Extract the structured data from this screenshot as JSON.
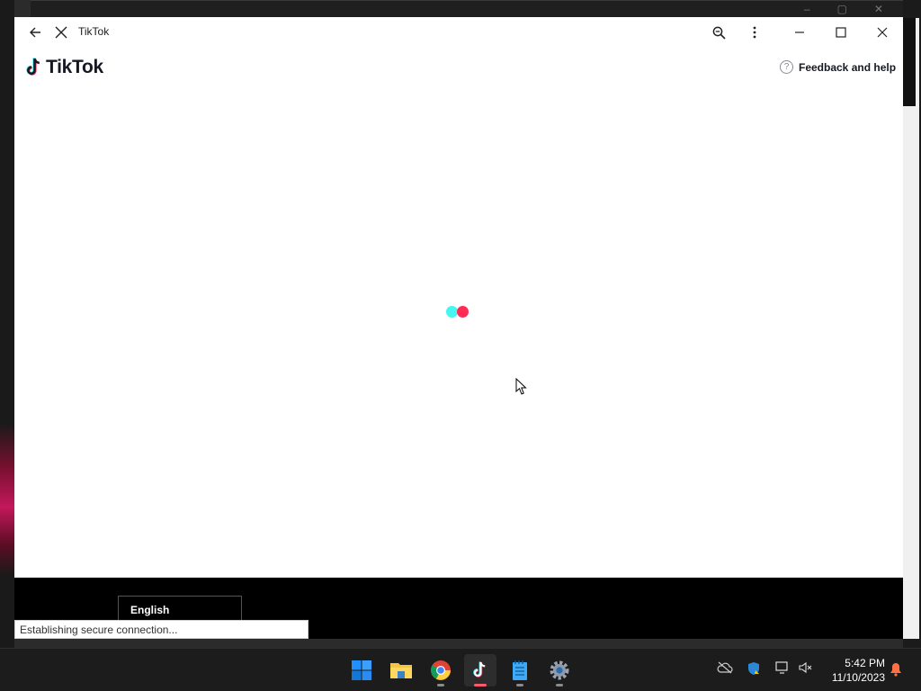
{
  "window": {
    "title": "TikTok"
  },
  "brand": {
    "name": "TikTok"
  },
  "header": {
    "help_label": "Feedback and help"
  },
  "footer": {
    "language": "English"
  },
  "status_bar": {
    "text": "Establishing secure connection..."
  },
  "loader": {
    "colors": [
      "#25f4ee",
      "#fe2c55"
    ]
  },
  "taskbar": {
    "apps": [
      "start-icon",
      "file-explorer-icon",
      "chrome-icon",
      "tiktok-icon",
      "notepad-icon",
      "settings-icon"
    ],
    "clock": {
      "time": "5:42 PM",
      "date": "11/10/2023"
    }
  }
}
